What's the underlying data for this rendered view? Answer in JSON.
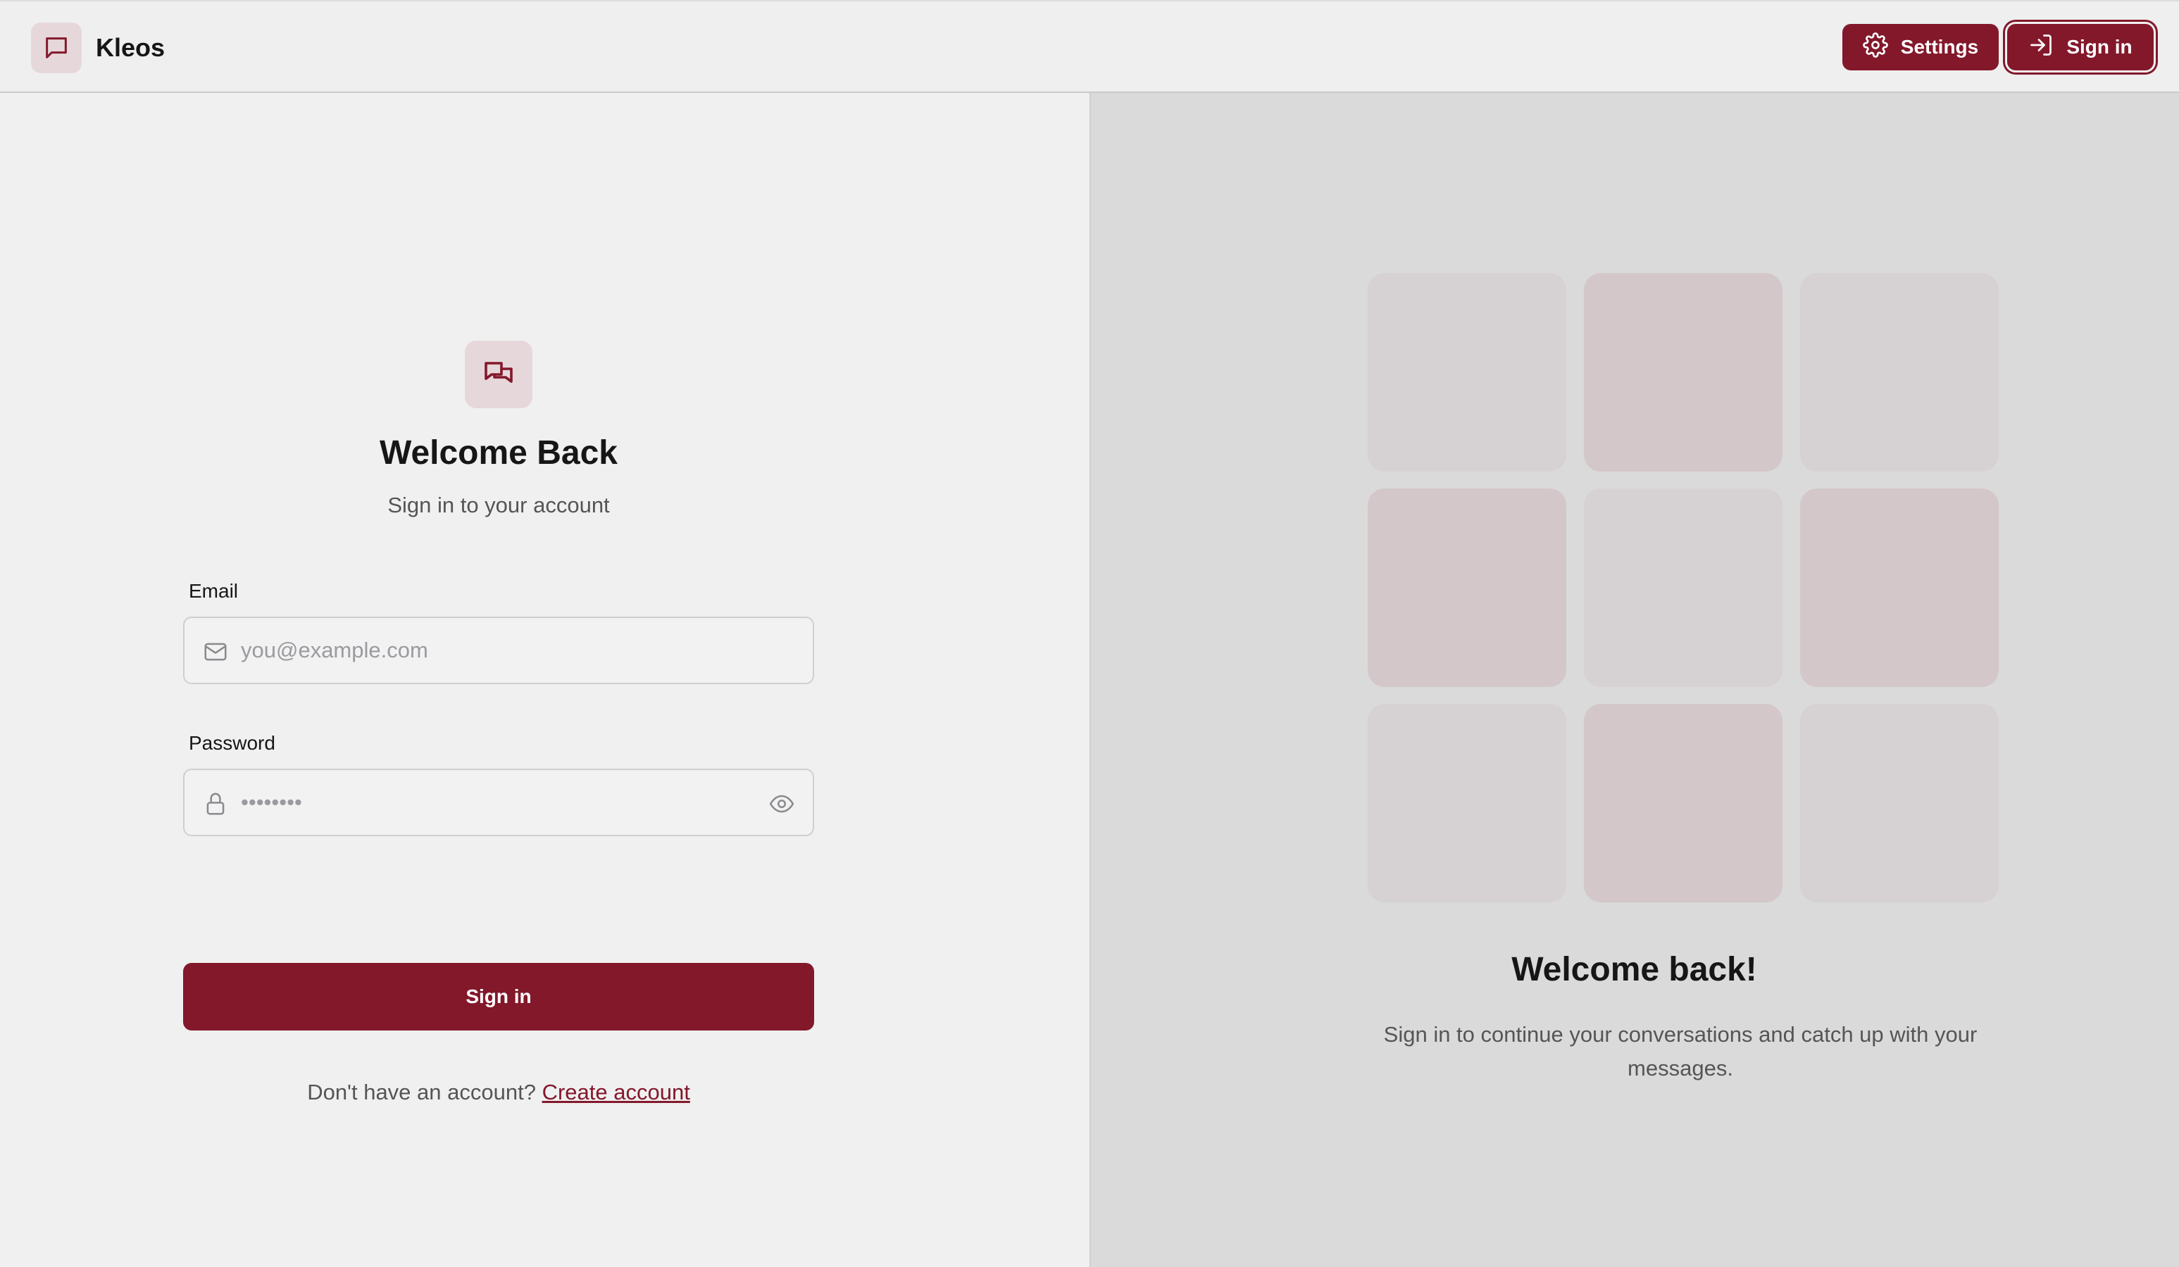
{
  "header": {
    "app_name": "Kleos",
    "settings_label": "Settings",
    "signin_label": "Sign in"
  },
  "login": {
    "title": "Welcome Back",
    "subtitle": "Sign in to your account",
    "email_label": "Email",
    "email_placeholder": "you@example.com",
    "email_value": "",
    "password_label": "Password",
    "password_placeholder": "••••••••",
    "password_value": "",
    "submit_label": "Sign in",
    "footer_text": "Don't have an account?",
    "create_account_label": "Create account"
  },
  "hero": {
    "title": "Welcome back!",
    "text": "Sign in to continue your conversations and catch up with your messages."
  },
  "icons": {
    "logo": "message-square-icon",
    "settings": "gear-icon",
    "signin": "log-in-icon",
    "chat": "messages-icon",
    "email": "mail-icon",
    "password": "lock-icon",
    "toggle": "eye-icon"
  },
  "colors": {
    "accent": "#83182b",
    "accent_soft": "#e6d8da",
    "tile_neutral": "#d6d2d3",
    "tile_tinted": "#d3c7c9"
  }
}
